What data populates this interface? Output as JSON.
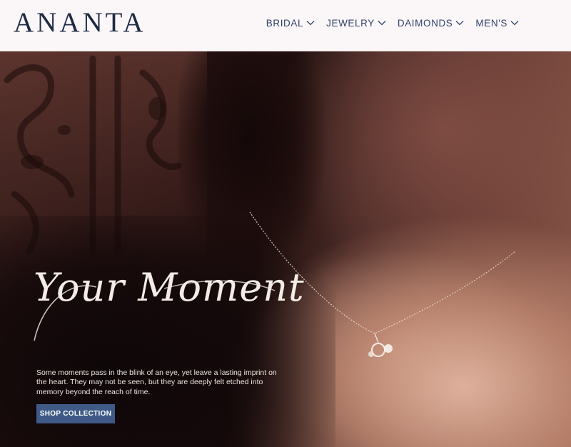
{
  "brand": {
    "logo_text": "ANANTA"
  },
  "nav": {
    "items": [
      {
        "label": "BRIDAL",
        "icon": "chevron-down-icon"
      },
      {
        "label": "JEWELRY",
        "icon": "chevron-down-icon"
      },
      {
        "label": "DAIMONDS",
        "icon": "chevron-down-icon"
      },
      {
        "label": "MEN'S",
        "icon": "chevron-down-icon"
      }
    ]
  },
  "hero": {
    "headline": "Your Moment",
    "description": "Some moments pass in the blink of an eye, yet leave a lasting imprint on the heart. They may not be seen, but they are deeply felt etched into memory beyond the reach of time.",
    "cta_label": "SHOP COLLECTION"
  },
  "colors": {
    "header_bg": "#fbf7f8",
    "logo": "#1f2a44",
    "nav_text": "#31426a",
    "cta_bg": "#3f5a86",
    "hero_text": "#f3ece6"
  }
}
